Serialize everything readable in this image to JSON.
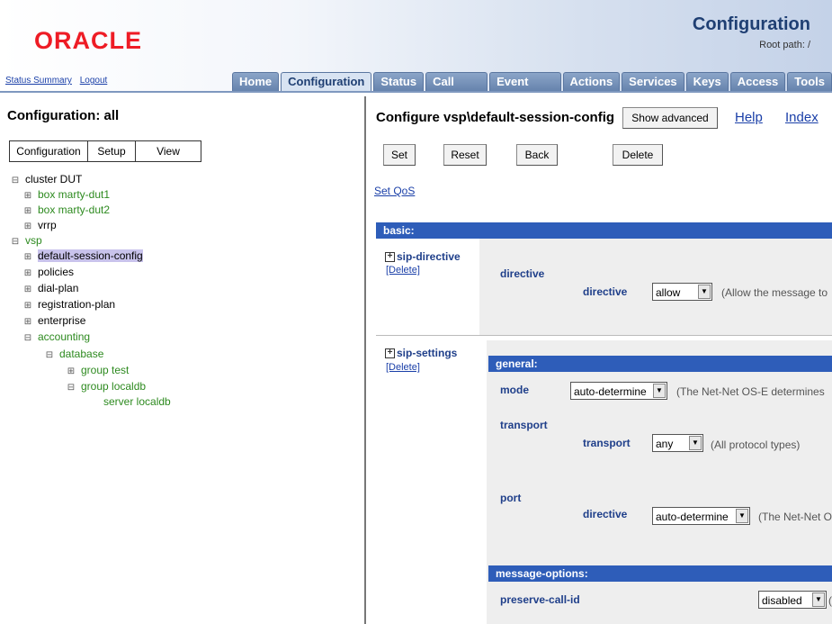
{
  "header": {
    "logo": "ORACLE",
    "title": "Configuration",
    "root_path": "Root path: /",
    "links": [
      "Status Summary",
      "Logout"
    ],
    "tabs": [
      "Home",
      "Configuration",
      "Status",
      "Call Logs",
      "Event Logs",
      "Actions",
      "Services",
      "Keys",
      "Access",
      "Tools"
    ],
    "active_tab": "Configuration"
  },
  "left": {
    "title": "Configuration: all",
    "tabs": [
      "Configuration",
      "Setup",
      "View"
    ],
    "tree": [
      {
        "label": "cluster DUT",
        "toggle": "minus"
      },
      {
        "label": "box marty-dut1",
        "toggle": "plus"
      },
      {
        "label": "box marty-dut2",
        "toggle": "plus"
      },
      {
        "label": "vrrp",
        "toggle": "plus"
      },
      {
        "label": "vsp",
        "toggle": "minus"
      },
      {
        "label": "default-session-config",
        "toggle": "plus",
        "selected": true
      },
      {
        "label": "policies",
        "toggle": "plus"
      },
      {
        "label": "dial-plan",
        "toggle": "plus"
      },
      {
        "label": "registration-plan",
        "toggle": "plus"
      },
      {
        "label": "enterprise",
        "toggle": "plus"
      },
      {
        "label": "accounting",
        "toggle": "minus"
      },
      {
        "label": "database",
        "toggle": "minus"
      },
      {
        "label": "group test",
        "toggle": "plus"
      },
      {
        "label": "group localdb",
        "toggle": "minus"
      },
      {
        "label": "server localdb",
        "toggle": "none"
      }
    ]
  },
  "right": {
    "title": "Configure vsp\\default-session-config",
    "show_advanced": "Show advanced",
    "help": "Help",
    "index": "Index",
    "buttons": {
      "set": "Set",
      "reset": "Reset",
      "back": "Back",
      "delete": "Delete"
    },
    "set_qos": "Set QoS",
    "basic_bar": "basic:",
    "sip_directive": {
      "label": "sip-directive",
      "delete": "[Delete]",
      "group": "directive",
      "field_label": "directive",
      "value": "allow",
      "hint": "(Allow the message to"
    },
    "sip_settings": {
      "label": "sip-settings",
      "delete": "[Delete]",
      "general_bar": "general:",
      "mode_label": "mode",
      "mode_value": "auto-determine",
      "mode_hint": "(The Net-Net OS-E determines",
      "transport_group": "transport",
      "transport_label": "transport",
      "transport_value": "any",
      "transport_hint": "(All protocol types)",
      "port_group": "port",
      "port_label": "directive",
      "port_value": "auto-determine",
      "port_hint": "(The Net-Net O",
      "message_options_bar": "message-options:",
      "preserve_label": "preserve-call-id",
      "preserve_value": "disabled",
      "preserve_hint": "("
    }
  },
  "colors": {
    "logo": "#ee1c25",
    "section_bar": "#2e5db9",
    "tree_green": "#2d8a1f",
    "selected_item": "#c9c3ec",
    "link": "#1a3fa8"
  }
}
